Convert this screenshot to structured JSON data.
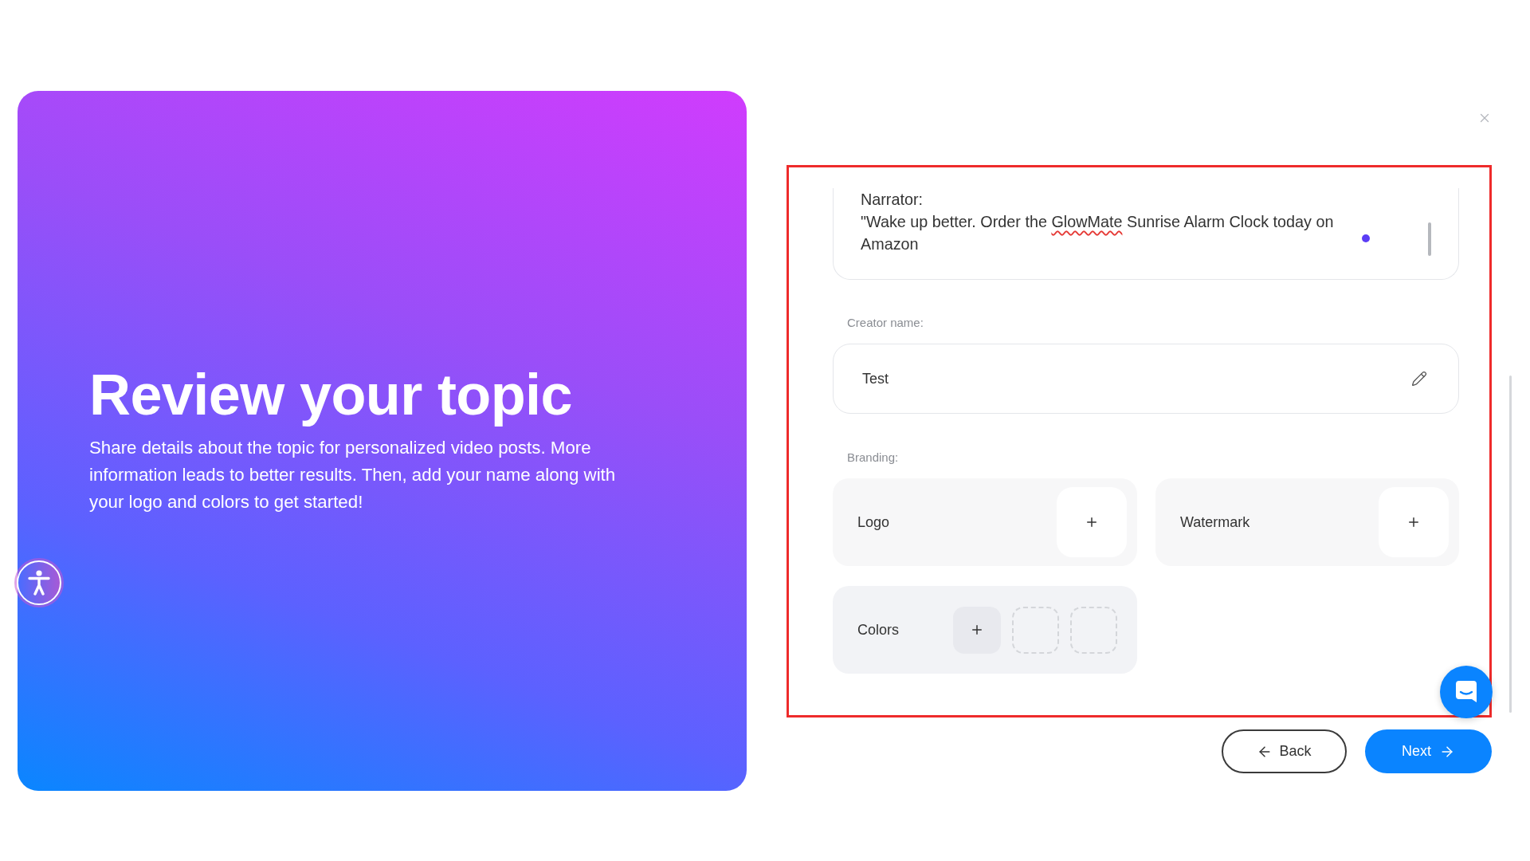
{
  "intro": {
    "title": "Review your topic",
    "description": "Share details about the topic for personalized video posts. More information leads to better results. Then, add your name along with your logo and colors to get started!"
  },
  "script_field": {
    "segments": [
      {
        "text": "Narrator:\n\"Wake up better. Order the ",
        "flagged": false
      },
      {
        "text": "GlowMate",
        "flagged": true
      },
      {
        "text": " Sunrise Alarm Clock today on Amazon",
        "flagged": false
      }
    ]
  },
  "creator_name": {
    "label": "Creator name:",
    "value": "Test"
  },
  "branding": {
    "label": "Branding:",
    "items": [
      {
        "kind": "upload",
        "label": "Logo"
      },
      {
        "kind": "upload",
        "label": "Watermark"
      },
      {
        "kind": "colors",
        "label": "Colors",
        "swatches": [
          {
            "filled": false
          },
          {
            "filled": false
          }
        ]
      }
    ]
  },
  "footer": {
    "back": {
      "label": "Back"
    },
    "next": {
      "label": "Next"
    }
  }
}
